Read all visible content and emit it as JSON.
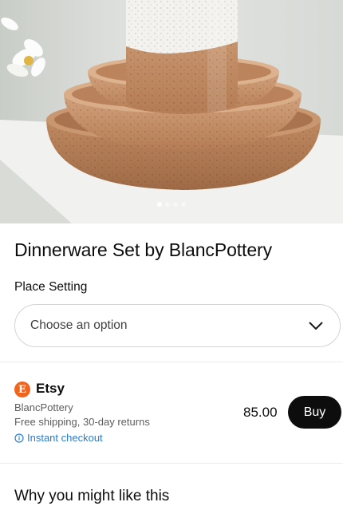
{
  "product": {
    "title": "Dinnerware Set by BlancPottery",
    "image_name": "ceramic-dinnerware-photo",
    "carousel": {
      "count": 4,
      "active_index": 0
    }
  },
  "variant": {
    "label": "Place Setting",
    "placeholder": "Choose an option"
  },
  "offer": {
    "store": "Etsy",
    "store_logo_letter": "E",
    "store_color": "#f1641e",
    "seller": "BlancPottery",
    "shipping": "Free shipping, 30-day returns",
    "checkout": "Instant checkout",
    "price": "85.00",
    "buy_label": "Buy"
  },
  "sections": {
    "why_title": "Why you might like this"
  },
  "colors": {
    "accent": "#2a7bd1",
    "button": "#0d0d0d"
  }
}
